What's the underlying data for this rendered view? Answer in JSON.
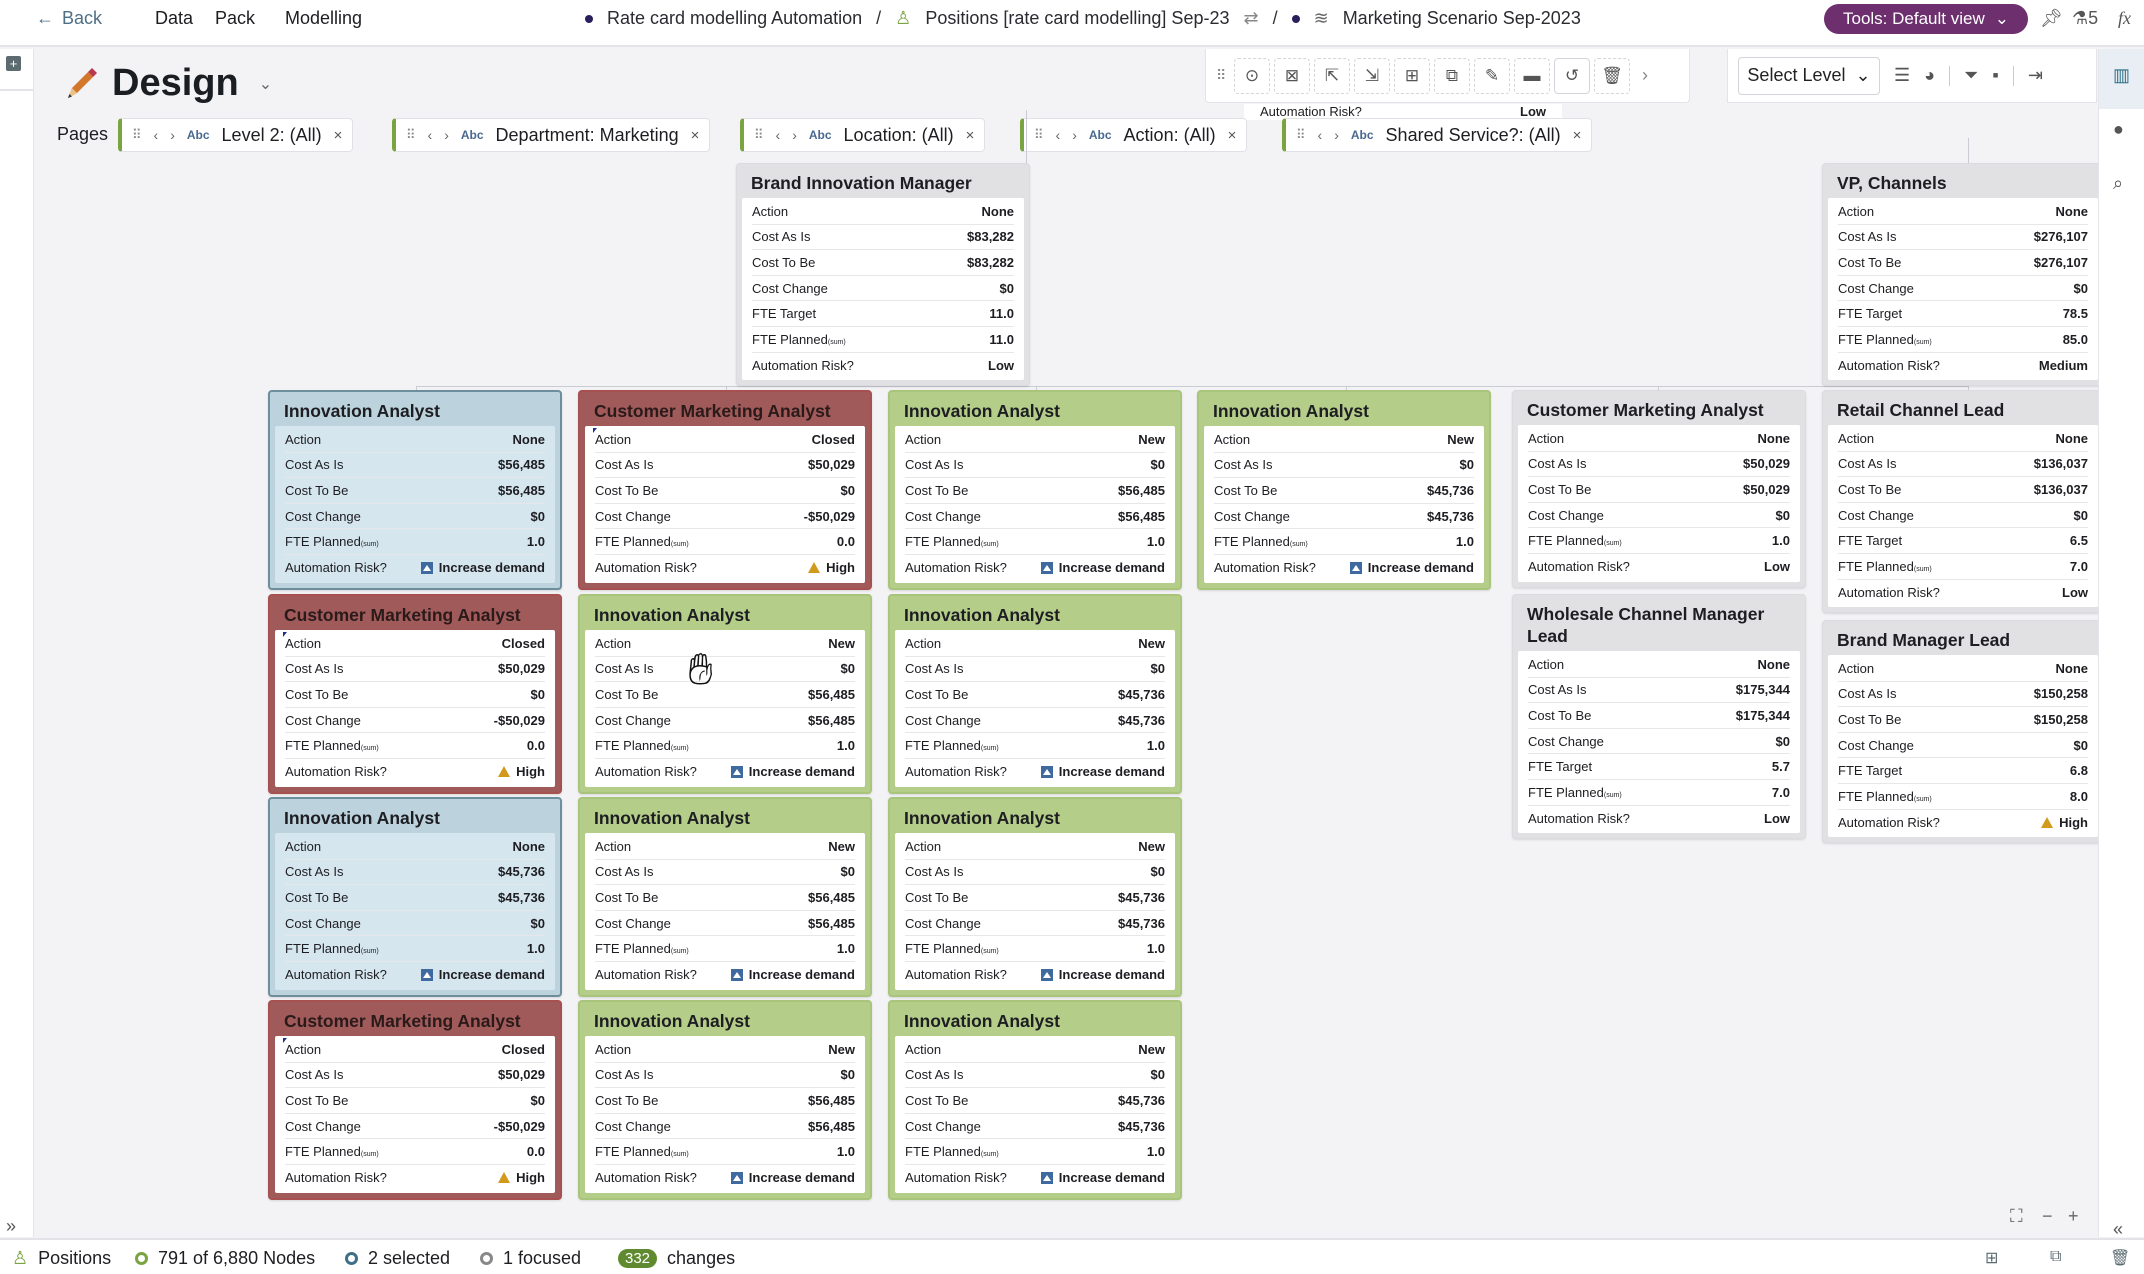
{
  "header": {
    "back_label": "Back",
    "nav": [
      "Data",
      "Pack",
      "Modelling"
    ],
    "breadcrumbs": [
      {
        "label": "Rate card modelling Automation",
        "icon": "dot-icon"
      },
      {
        "label": "Positions [rate card modelling] Sep-23",
        "icon": "person-icon"
      },
      {
        "label": "Marketing Scenario Sep-2023",
        "icon": "layers-icon"
      }
    ],
    "separator": "/",
    "tools_label": "Tools: Default view",
    "flask_count": "5",
    "fx_label": "fx"
  },
  "page": {
    "title": "Design",
    "pages_label": "Pages"
  },
  "toolbar": {
    "select_level": "Select Level"
  },
  "filters": [
    {
      "label": "Level 2: (All)"
    },
    {
      "label": "Department: Marketing"
    },
    {
      "label": "Location: (All)"
    },
    {
      "label": "Action: (All)"
    },
    {
      "label": "Shared Service?: (All)"
    }
  ],
  "abc_label": "Abc",
  "labels": {
    "action": "Action",
    "cost_as_is": "Cost As Is",
    "cost_to_be": "Cost To Be",
    "cost_change": "Cost Change",
    "fte_target": "FTE Target",
    "fte_planned": "FTE Planned",
    "fte_planned_sub": "(sum)",
    "automation_risk": "Automation Risk?"
  },
  "cards": [
    {
      "title": "Brand Innovation Manager",
      "style": "grey",
      "action": "None",
      "cost_as_is": "$83,282",
      "cost_to_be": "$83,282",
      "cost_change": "$0",
      "fte_target": "11.0",
      "fte_planned": "11.0",
      "risk": "Low",
      "risk_icon": ""
    },
    {
      "title": "VP, Channels",
      "style": "grey",
      "action": "None",
      "cost_as_is": "$276,107",
      "cost_to_be": "$276,107",
      "cost_change": "$0",
      "fte_target": "78.5",
      "fte_planned": "85.0",
      "risk": "Medium",
      "risk_icon": ""
    },
    {
      "title": "Innovation Analyst",
      "style": "blue",
      "action": "None",
      "cost_as_is": "$56,485",
      "cost_to_be": "$56,485",
      "cost_change": "$0",
      "fte_planned": "1.0",
      "risk": "Increase demand",
      "risk_icon": "increase"
    },
    {
      "title": "Customer Marketing Analyst",
      "style": "red",
      "action": "Closed",
      "cost_as_is": "$50,029",
      "cost_to_be": "$0",
      "cost_change": "-$50,029",
      "fte_planned": "0.0",
      "risk": "High",
      "risk_icon": "warning"
    },
    {
      "title": "Innovation Analyst",
      "style": "green",
      "action": "New",
      "cost_as_is": "$0",
      "cost_to_be": "$56,485",
      "cost_change": "$56,485",
      "fte_planned": "1.0",
      "risk": "Increase demand",
      "risk_icon": "increase"
    },
    {
      "title": "Innovation Analyst",
      "style": "green",
      "action": "New",
      "cost_as_is": "$0",
      "cost_to_be": "$45,736",
      "cost_change": "$45,736",
      "fte_planned": "1.0",
      "risk": "Increase demand",
      "risk_icon": "increase"
    },
    {
      "title": "Customer Marketing Analyst",
      "style": "grey",
      "action": "None",
      "cost_as_is": "$50,029",
      "cost_to_be": "$50,029",
      "cost_change": "$0",
      "fte_planned": "1.0",
      "risk": "Low",
      "risk_icon": ""
    },
    {
      "title": "Retail Channel Lead",
      "style": "grey",
      "action": "None",
      "cost_as_is": "$136,037",
      "cost_to_be": "$136,037",
      "cost_change": "$0",
      "fte_target": "6.5",
      "fte_planned": "7.0",
      "risk": "Low",
      "risk_icon": ""
    },
    {
      "title": "Customer Marketing Analyst",
      "style": "red",
      "action": "Closed",
      "cost_as_is": "$50,029",
      "cost_to_be": "$0",
      "cost_change": "-$50,029",
      "fte_planned": "0.0",
      "risk": "High",
      "risk_icon": "warning"
    },
    {
      "title": "Innovation Analyst",
      "style": "green",
      "action": "New",
      "cost_as_is": "$0",
      "cost_to_be": "$56,485",
      "cost_change": "$56,485",
      "fte_planned": "1.0",
      "risk": "Increase demand",
      "risk_icon": "increase"
    },
    {
      "title": "Innovation Analyst",
      "style": "green",
      "action": "New",
      "cost_as_is": "$0",
      "cost_to_be": "$45,736",
      "cost_change": "$45,736",
      "fte_planned": "1.0",
      "risk": "Increase demand",
      "risk_icon": "increase"
    },
    {
      "title": "Wholesale Channel Manager Lead",
      "style": "grey",
      "action": "None",
      "cost_as_is": "$175,344",
      "cost_to_be": "$175,344",
      "cost_change": "$0",
      "fte_target": "5.7",
      "fte_planned": "7.0",
      "risk": "Low",
      "risk_icon": ""
    },
    {
      "title": "Brand Manager Lead",
      "style": "grey",
      "action": "None",
      "cost_as_is": "$150,258",
      "cost_to_be": "$150,258",
      "cost_change": "$0",
      "fte_target": "6.8",
      "fte_planned": "8.0",
      "risk": "High",
      "risk_icon": "warning"
    },
    {
      "title": "Innovation Analyst",
      "style": "blue",
      "action": "None",
      "cost_as_is": "$45,736",
      "cost_to_be": "$45,736",
      "cost_change": "$0",
      "fte_planned": "1.0",
      "risk": "Increase demand",
      "risk_icon": "increase"
    },
    {
      "title": "Innovation Analyst",
      "style": "green",
      "action": "New",
      "cost_as_is": "$0",
      "cost_to_be": "$56,485",
      "cost_change": "$56,485",
      "fte_planned": "1.0",
      "risk": "Increase demand",
      "risk_icon": "increase"
    },
    {
      "title": "Innovation Analyst",
      "style": "green",
      "action": "New",
      "cost_as_is": "$0",
      "cost_to_be": "$45,736",
      "cost_change": "$45,736",
      "fte_planned": "1.0",
      "risk": "Increase demand",
      "risk_icon": "increase"
    },
    {
      "title": "Customer Marketing Analyst",
      "style": "red",
      "action": "Closed",
      "cost_as_is": "$50,029",
      "cost_to_be": "$0",
      "cost_change": "-$50,029",
      "fte_planned": "0.0",
      "risk": "High",
      "risk_icon": "warning"
    },
    {
      "title": "Innovation Analyst",
      "style": "green",
      "action": "New",
      "cost_as_is": "$0",
      "cost_to_be": "$56,485",
      "cost_change": "$56,485",
      "fte_planned": "1.0",
      "risk": "Increase demand",
      "risk_icon": "increase"
    },
    {
      "title": "Innovation Analyst",
      "style": "green",
      "action": "New",
      "cost_as_is": "$0",
      "cost_to_be": "$45,736",
      "cost_change": "$45,736",
      "fte_planned": "1.0",
      "risk": "Increase demand",
      "risk_icon": "increase"
    }
  ],
  "overlap_text": {
    "label": "Automation Risk?",
    "value": "Low"
  },
  "status": {
    "module": "Positions",
    "nodes": "791 of 6,880 Nodes",
    "selected": "2 selected",
    "focused": "1 focused",
    "changes_count": "332",
    "changes_label": "changes"
  }
}
